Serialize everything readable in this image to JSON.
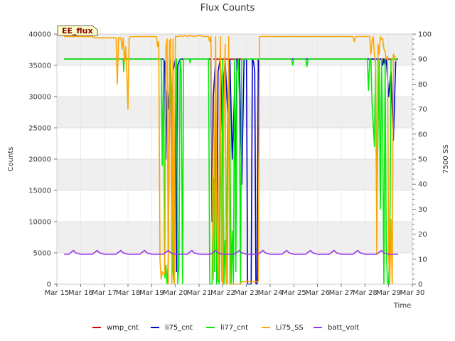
{
  "chart_data": {
    "type": "line",
    "title": "Flux Counts",
    "tag": "EE_flux",
    "xlabel": "Time",
    "ylabel": "Counts",
    "y2label": "7500 SS",
    "grid": true,
    "legend_position": "bottom-center",
    "x_ticks": [
      "Mar 15",
      "Mar 16",
      "Mar 17",
      "Mar 18",
      "Mar 19",
      "Mar 20",
      "Mar 21",
      "Mar 22",
      "Mar 23",
      "Mar 24",
      "Mar 25",
      "Mar 26",
      "Mar 27",
      "Mar 28",
      "Mar 29",
      "Mar 30"
    ],
    "xlim": [
      15,
      30
    ],
    "ylim": [
      0,
      40000
    ],
    "y_ticks": [
      0,
      5000,
      10000,
      15000,
      20000,
      25000,
      30000,
      35000,
      40000
    ],
    "y2lim": [
      0,
      100
    ],
    "y2_ticks": [
      0,
      10,
      20,
      30,
      40,
      50,
      60,
      70,
      80,
      90,
      100
    ],
    "x_unit": "day of March",
    "series": [
      {
        "name": "wmp_cnt",
        "color": "#dd0000",
        "axis": "left",
        "x": [
          15.3,
          19.5,
          19.5,
          21.5,
          21.6,
          23.4,
          23.5,
          29.4
        ],
        "y": [
          36000,
          36000,
          null,
          null,
          36000,
          36000,
          36000,
          36000
        ]
      },
      {
        "name": "li75_cnt",
        "color": "#0000cc",
        "axis": "left",
        "x": [
          15.3,
          19.5,
          19.55,
          19.6,
          19.65,
          19.7,
          19.75,
          19.8,
          19.85,
          19.9,
          20.0,
          20.05,
          20.1,
          20.2,
          20.25,
          21.5,
          21.55,
          21.6,
          21.7,
          21.75,
          21.8,
          21.9,
          22.0,
          22.05,
          22.1,
          22.2,
          22.25,
          22.3,
          22.4,
          22.5,
          22.55,
          22.6,
          22.7,
          22.8,
          22.9,
          23.0,
          23.05,
          23.1,
          23.2,
          23.25,
          23.3,
          23.35,
          23.4,
          23.45,
          23.5,
          28.4,
          28.5,
          28.55,
          28.6,
          28.65,
          28.7,
          28.75,
          28.8,
          28.85,
          28.9,
          29.0,
          29.1,
          29.2,
          29.3
        ],
        "y": [
          36000,
          36000,
          35500,
          20000,
          31000,
          28000,
          32000,
          36000,
          5000,
          34000,
          36000,
          2000,
          35000,
          36000,
          36000,
          36000,
          10000,
          30000,
          36000,
          0,
          34000,
          36000,
          22000,
          33000,
          36000,
          28000,
          24000,
          36000,
          20000,
          31000,
          17000,
          36000,
          36000,
          16000,
          36000,
          36000,
          0,
          0,
          0,
          36000,
          35500,
          34000,
          0,
          0,
          36000,
          36000,
          36000,
          36000,
          36000,
          36000,
          36000,
          35000,
          36000,
          35000,
          36000,
          30000,
          34000,
          23000,
          36000
        ]
      },
      {
        "name": "li77_cnt",
        "color": "#00ee00",
        "axis": "left",
        "x": [
          15.3,
          17.8,
          17.82,
          17.85,
          17.9,
          19.4,
          19.45,
          19.5,
          19.55,
          19.6,
          19.65,
          19.7,
          19.75,
          19.8,
          19.85,
          19.9,
          19.95,
          20.0,
          20.05,
          20.1,
          20.15,
          20.2,
          20.25,
          20.3,
          20.35,
          20.6,
          20.62,
          20.65,
          21.4,
          21.45,
          21.5,
          21.55,
          21.6,
          21.65,
          21.7,
          21.75,
          21.8,
          21.85,
          21.9,
          21.95,
          22.0,
          22.05,
          22.1,
          22.15,
          22.2,
          22.25,
          22.3,
          22.35,
          22.4,
          22.45,
          22.5,
          22.55,
          22.6,
          22.65,
          22.7,
          22.75,
          22.8,
          22.85,
          22.9,
          22.95,
          23.0,
          24.9,
          24.95,
          25.0,
          25.5,
          25.55,
          25.6,
          28.1,
          28.15,
          28.2,
          28.25,
          28.3,
          28.4,
          28.45,
          28.5,
          28.55,
          28.6,
          28.65,
          28.7,
          28.75,
          28.8,
          28.85,
          28.9,
          28.95,
          29.0,
          29.05,
          29.1,
          29.15,
          29.2,
          29.25,
          29.3,
          29.35
        ],
        "y": [
          36000,
          36000,
          34000,
          37000,
          36000,
          36000,
          19000,
          36000,
          1000,
          3000,
          0,
          4000,
          27000,
          36000,
          29000,
          2000,
          0,
          36000,
          36000,
          0,
          3000,
          36000,
          34000,
          0,
          36000,
          36000,
          35400,
          36000,
          36000,
          0,
          0,
          0,
          17000,
          2000,
          36000,
          0,
          1500,
          0,
          30000,
          2000,
          36000,
          0,
          7000,
          0,
          25000,
          36000,
          26000,
          0,
          8500,
          0,
          36000,
          2000,
          34000,
          36000,
          30000,
          0,
          36000,
          36000,
          36000,
          36000,
          36000,
          36000,
          35000,
          36000,
          36000,
          34800,
          36000,
          36000,
          31000,
          36000,
          36000,
          29000,
          22000,
          36000,
          12000,
          24000,
          36000,
          12000,
          36000,
          24000,
          0,
          36000,
          6500,
          0,
          0,
          6000,
          36000,
          36000,
          36000,
          36000,
          36000,
          36000
        ],
        "y2_equivalent_note": ""
      },
      {
        "name": "Li75_SS",
        "color": "#ffa500",
        "axis": "right",
        "x": [
          15.3,
          16.5,
          16.6,
          17.5,
          17.55,
          17.6,
          17.7,
          17.75,
          17.8,
          17.85,
          17.9,
          17.95,
          18.0,
          18.05,
          18.1,
          18.15,
          18.2,
          18.3,
          19.2,
          19.25,
          19.3,
          19.35,
          19.4,
          19.45,
          19.5,
          19.55,
          19.6,
          19.65,
          19.7,
          19.75,
          19.8,
          19.85,
          19.9,
          19.95,
          20.0,
          20.05,
          20.1,
          20.15,
          20.2,
          20.3,
          20.4,
          20.5,
          20.6,
          20.8,
          21.0,
          21.2,
          21.4,
          21.45,
          21.5,
          21.55,
          21.6,
          21.65,
          21.7,
          21.75,
          21.8,
          21.85,
          21.9,
          21.95,
          22.0,
          22.05,
          22.1,
          22.15,
          22.2,
          22.25,
          22.3,
          22.35,
          22.4,
          22.45,
          22.5,
          22.55,
          22.6,
          22.65,
          22.7,
          22.75,
          22.8,
          22.9,
          23.0,
          23.5,
          23.55,
          23.6,
          24.0,
          25.0,
          26.0,
          27.0,
          27.5,
          27.55,
          27.6,
          28.0,
          28.2,
          28.25,
          28.3,
          28.35,
          28.4,
          28.45,
          28.5,
          28.55,
          28.6,
          28.65,
          28.7,
          28.75,
          28.8,
          28.85,
          28.9,
          28.95,
          29.0,
          29.05,
          29.1,
          29.15,
          29.2,
          29.25,
          29.3
        ],
        "y": [
          99,
          99,
          98.5,
          98.5,
          80,
          98.5,
          98.5,
          94,
          98.5,
          89,
          95,
          85,
          70,
          98.5,
          99,
          99,
          99,
          99,
          99,
          95,
          97,
          10,
          2,
          5,
          4,
          4,
          95,
          98,
          0,
          97,
          98,
          0,
          98,
          0,
          99,
          99,
          99,
          99,
          99.5,
          99,
          99.5,
          99,
          99.5,
          99,
          99.5,
          99,
          99,
          97,
          99,
          50,
          2,
          52,
          99,
          28,
          2,
          40,
          99,
          2,
          0,
          70,
          96,
          0,
          0,
          99,
          0,
          0,
          0,
          0,
          0,
          0,
          0,
          0,
          0,
          0,
          1,
          1,
          1,
          1,
          99,
          99,
          99,
          99,
          99,
          99,
          99,
          97,
          99,
          99,
          99,
          92,
          97,
          99,
          92,
          88,
          12,
          96,
          92,
          99,
          98,
          98,
          94,
          93,
          90,
          91,
          12,
          0,
          26,
          0,
          92,
          91,
          89
        ],
        "y2_equivalent_note": ""
      },
      {
        "name": "batt_volt",
        "color": "#9933ee",
        "axis": "right",
        "x": [
          15.3,
          15.5,
          15.7,
          15.8,
          16.0,
          16.2,
          16.5,
          16.7,
          16.8,
          17.0,
          17.2,
          17.5,
          17.7,
          17.8,
          18.0,
          18.2,
          18.5,
          18.7,
          18.8,
          19.0,
          19.2,
          19.5,
          19.7,
          19.8,
          20.0,
          20.2,
          20.5,
          20.7,
          20.8,
          21.0,
          21.2,
          21.5,
          21.7,
          21.8,
          22.0,
          22.2,
          22.5,
          22.7,
          22.8,
          23.0,
          23.2,
          23.5,
          23.7,
          23.8,
          24.0,
          24.2,
          24.5,
          24.7,
          24.8,
          25.0,
          25.2,
          25.5,
          25.7,
          25.8,
          26.0,
          26.2,
          26.5,
          26.7,
          26.8,
          27.0,
          27.2,
          27.5,
          27.7,
          27.8,
          28.0,
          28.2,
          28.5,
          28.7,
          28.8,
          29.0,
          29.2,
          29.4
        ],
        "y": [
          12,
          12,
          13.5,
          12.5,
          12,
          12,
          12,
          13.5,
          12.5,
          12,
          12,
          12,
          13.5,
          12.5,
          12,
          12,
          12,
          13.5,
          12.5,
          12,
          12,
          12,
          13.5,
          12.5,
          12,
          12,
          12,
          13.5,
          12.5,
          12,
          12,
          12,
          13.5,
          12.5,
          12,
          12,
          12,
          13.5,
          12.5,
          12,
          12,
          12,
          13.5,
          12.5,
          12,
          12,
          12,
          13.5,
          12.5,
          12,
          12,
          12,
          13.5,
          12.5,
          12,
          12,
          12,
          13.5,
          12.5,
          12,
          12,
          12,
          13.5,
          12.5,
          12,
          12,
          12,
          13.5,
          12.5,
          12,
          12,
          12
        ],
        "y2_equivalent_note": ""
      }
    ]
  }
}
